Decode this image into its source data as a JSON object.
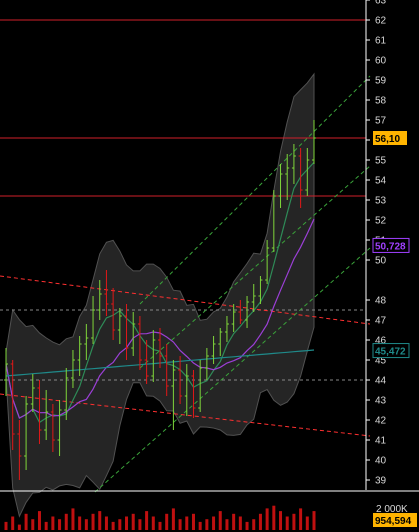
{
  "chart_data": {
    "type": "candlestick",
    "ylim": [
      38.5,
      63
    ],
    "y_ticks": [
      39,
      40,
      41,
      42,
      43,
      44,
      45,
      46,
      47,
      48,
      50,
      51,
      52,
      53,
      54,
      55,
      56,
      57,
      58,
      59,
      60,
      61,
      62,
      63
    ],
    "y_tick_labels": [
      "39",
      "40",
      "41",
      "42",
      "43",
      "44",
      "45",
      "46",
      "47",
      "48",
      "50",
      "51",
      "52",
      "53",
      "54",
      "55",
      "56",
      "57",
      "58",
      "59",
      "60",
      "61",
      "62",
      "63"
    ],
    "price_tag": {
      "label": "56,10",
      "value": 56.1,
      "bg": "#ffb400",
      "fg": "#000000"
    },
    "indicator_tags": [
      {
        "label": "50,728",
        "value": 50.728,
        "color": "#a040ff"
      },
      {
        "label": "45,472",
        "value": 45.472,
        "color": "#1f8a8a"
      }
    ],
    "horizontal_lines": [
      {
        "value": 62.0,
        "color": "#d01f2a",
        "style": "solid"
      },
      {
        "value": 56.1,
        "color": "#d01f2a",
        "style": "solid"
      },
      {
        "value": 53.2,
        "color": "#d01f2a",
        "style": "solid"
      },
      {
        "value": 47.5,
        "color": "#888888",
        "style": "dashed"
      },
      {
        "value": 44.0,
        "color": "#888888",
        "style": "dashed"
      }
    ],
    "trend_lines": [
      {
        "name": "red-channel-upper",
        "x": [
          0,
          370
        ],
        "y": [
          49.2,
          46.8
        ],
        "color": "#ff3030"
      },
      {
        "name": "red-channel-lower",
        "x": [
          0,
          370
        ],
        "y": [
          43.3,
          41.2
        ],
        "color": "#ff3030"
      },
      {
        "name": "green-channel-upper",
        "x": [
          140,
          370
        ],
        "y": [
          47.8,
          59.2
        ],
        "color": "#3aa33a"
      },
      {
        "name": "green-channel-mid",
        "x": [
          140,
          370
        ],
        "y": [
          44.6,
          54.7
        ],
        "color": "#3aa33a"
      },
      {
        "name": "green-channel-lower",
        "x": [
          95,
          370
        ],
        "y": [
          38.4,
          50.6
        ],
        "color": "#3aa33a"
      }
    ],
    "bars": [
      [
        44.0,
        45.6,
        43.2,
        44.8
      ],
      [
        44.8,
        45.0,
        40.5,
        41.3
      ],
      [
        41.3,
        42.0,
        39.0,
        40.2
      ],
      [
        40.2,
        43.2,
        39.5,
        42.8
      ],
      [
        42.8,
        44.3,
        42.4,
        43.6
      ],
      [
        43.6,
        44.0,
        40.8,
        41.5
      ],
      [
        41.5,
        43.5,
        41.0,
        42.4
      ],
      [
        42.4,
        42.8,
        40.4,
        41.0
      ],
      [
        41.0,
        43.0,
        40.2,
        42.5
      ],
      [
        42.5,
        44.6,
        42.0,
        44.1
      ],
      [
        44.1,
        45.5,
        43.6,
        45.0
      ],
      [
        45.0,
        46.2,
        44.2,
        45.8
      ],
      [
        45.8,
        46.8,
        45.0,
        46.1
      ],
      [
        46.1,
        48.2,
        45.8,
        47.5
      ],
      [
        47.5,
        49.0,
        47.0,
        48.3
      ],
      [
        48.3,
        49.5,
        47.2,
        47.8
      ],
      [
        47.8,
        48.6,
        46.0,
        46.5
      ],
      [
        46.5,
        47.6,
        45.8,
        47.2
      ],
      [
        47.2,
        47.8,
        45.0,
        45.6
      ],
      [
        45.6,
        47.4,
        45.2,
        46.8
      ],
      [
        46.8,
        47.2,
        44.5,
        45.0
      ],
      [
        45.0,
        46.0,
        43.8,
        44.2
      ],
      [
        44.2,
        46.5,
        43.9,
        46.0
      ],
      [
        46.0,
        46.6,
        44.6,
        45.2
      ],
      [
        45.2,
        45.8,
        43.2,
        43.7
      ],
      [
        43.7,
        45.0,
        41.5,
        44.5
      ],
      [
        44.5,
        45.2,
        42.8,
        43.2
      ],
      [
        43.2,
        44.8,
        42.2,
        44.2
      ],
      [
        44.2,
        44.5,
        42.1,
        42.6
      ],
      [
        42.6,
        45.0,
        42.4,
        44.6
      ],
      [
        44.6,
        45.6,
        44.0,
        45.2
      ],
      [
        45.2,
        46.2,
        44.8,
        45.8
      ],
      [
        45.8,
        46.6,
        45.2,
        46.4
      ],
      [
        46.4,
        47.2,
        45.9,
        46.8
      ],
      [
        46.8,
        47.8,
        46.4,
        47.4
      ],
      [
        47.4,
        48.0,
        46.8,
        47.0
      ],
      [
        47.0,
        48.2,
        46.6,
        47.9
      ],
      [
        47.9,
        48.8,
        47.4,
        48.2
      ],
      [
        48.2,
        49.2,
        47.8,
        49.0
      ],
      [
        49.0,
        51.0,
        48.8,
        50.6
      ],
      [
        50.6,
        53.5,
        50.4,
        53.2
      ],
      [
        53.2,
        54.8,
        52.6,
        54.3
      ],
      [
        54.3,
        55.3,
        53.0,
        54.6
      ],
      [
        54.6,
        55.8,
        53.8,
        55.2
      ],
      [
        55.2,
        55.6,
        52.6,
        53.5
      ],
      [
        53.5,
        55.6,
        53.2,
        55.0
      ],
      [
        55.0,
        57.0,
        54.8,
        56.1
      ]
    ],
    "volume": [
      0.3,
      0.5,
      0.2,
      0.6,
      0.4,
      0.7,
      0.3,
      0.5,
      0.4,
      0.6,
      0.8,
      0.5,
      0.4,
      0.6,
      0.7,
      0.5,
      0.3,
      0.4,
      0.5,
      0.6,
      0.4,
      0.7,
      0.5,
      0.3,
      0.6,
      0.8,
      0.4,
      0.5,
      0.6,
      0.3,
      0.4,
      0.5,
      0.7,
      0.4,
      0.6,
      0.5,
      0.3,
      0.4,
      0.6,
      0.8,
      0.9,
      0.7,
      0.5,
      0.6,
      0.8,
      0.5,
      0.7
    ],
    "volume_tags": [
      {
        "label": "2 000K",
        "color": "#d8d8d8"
      },
      {
        "label": "954,594",
        "bg": "#ffb400",
        "fg": "#000000"
      }
    ],
    "colors": {
      "background": "#000000",
      "up": "#7fd63a",
      "down": "#e01818",
      "band_fill": "#2a2a2a",
      "band_edge": "#5a5a5a",
      "ma_purple": "#9b3fd6",
      "ma_teal": "#1f8a8a",
      "ma_green": "#2e8b57",
      "volume": "#c01010"
    }
  }
}
